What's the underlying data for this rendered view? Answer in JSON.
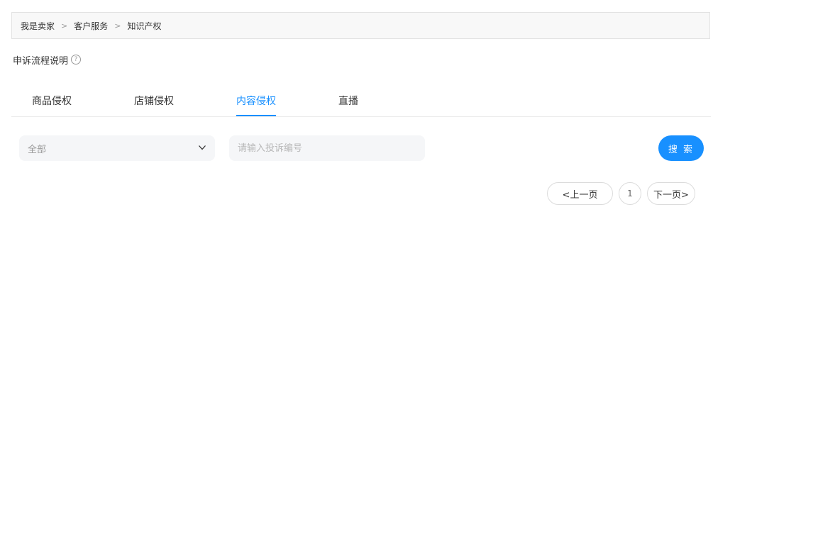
{
  "breadcrumb": {
    "items": [
      "我是卖家",
      "客户服务",
      "知识产权"
    ],
    "separator": ">"
  },
  "help": {
    "label": "申诉流程说明",
    "icon": "question-circle-icon",
    "icon_glyph": "?"
  },
  "tabs": [
    {
      "label": "商品侵权",
      "active": false
    },
    {
      "label": "店铺侵权",
      "active": false
    },
    {
      "label": "内容侵权",
      "active": true
    },
    {
      "label": "直播",
      "active": false
    }
  ],
  "filter": {
    "select_value": "全部",
    "search_placeholder": "请输入投诉编号",
    "search_button": "搜 索"
  },
  "pagination": {
    "prev": "<上一页",
    "current_page": "1",
    "next": "下一页>"
  },
  "colors": {
    "accent": "#1890ff",
    "input_bg": "#f5f6f8",
    "breadcrumb_bg": "#f8f8f8"
  }
}
